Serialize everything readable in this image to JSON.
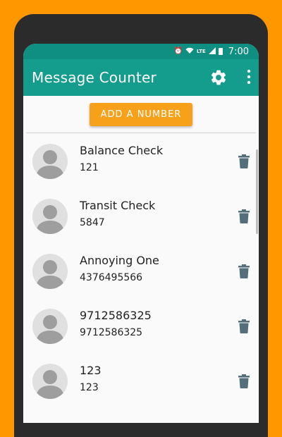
{
  "status_bar": {
    "network": "LTE",
    "time": "7:00"
  },
  "app_bar": {
    "title": "Message Counter",
    "settings_icon": "gear-icon",
    "overflow_icon": "more-vert-icon"
  },
  "add_button_label": "ADD A NUMBER",
  "colors": {
    "background": "#FF9800",
    "primary": "#149c8d",
    "status_bar": "#0f8f82",
    "accent": "#F7A11A"
  },
  "contacts": [
    {
      "name": "Balance Check",
      "number": "121"
    },
    {
      "name": "Transit Check",
      "number": "5847"
    },
    {
      "name": "Annoying One",
      "number": "4376495566"
    },
    {
      "name": "9712586325",
      "number": "9712586325"
    },
    {
      "name": "123",
      "number": "123"
    }
  ]
}
